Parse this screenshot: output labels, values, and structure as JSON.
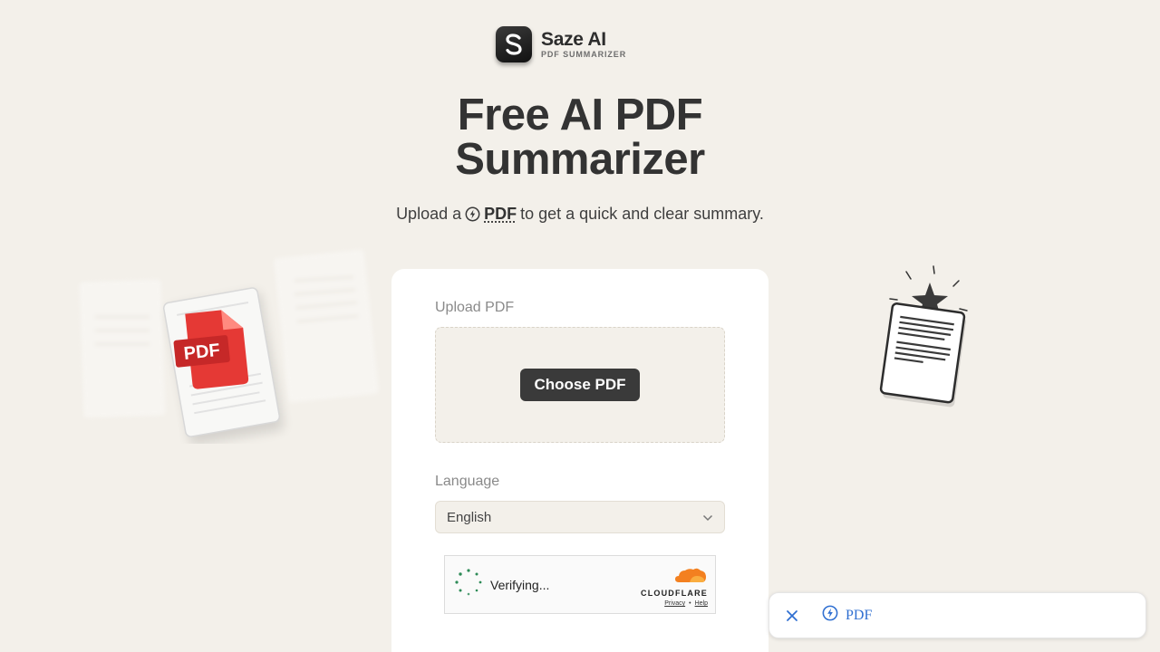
{
  "brand": {
    "name": "Saze AI",
    "subtitle": "PDF SUMMARIZER",
    "logo_letter": "S"
  },
  "hero": {
    "title_line1": "Free AI PDF",
    "title_line2": "Summarizer",
    "subtitle_pre": "Upload a",
    "subtitle_link": "PDF",
    "subtitle_post": "to get a quick and clear summary."
  },
  "form": {
    "upload_label": "Upload PDF",
    "choose_button": "Choose PDF",
    "language_label": "Language",
    "language_value": "English"
  },
  "captcha": {
    "status": "Verifying...",
    "brand": "CLOUDFLARE",
    "privacy_link": "Privacy",
    "separator": "•",
    "help_link": "Help"
  },
  "deco": {
    "pdf_badge": "PDF"
  },
  "popup": {
    "item_label": "PDF"
  },
  "colors": {
    "background": "#f3f0ea",
    "accent_dark": "#3a3a3a",
    "pdf_red": "#e53935",
    "cloudflare_orange": "#f38020",
    "link_blue": "#2f6fd1"
  }
}
